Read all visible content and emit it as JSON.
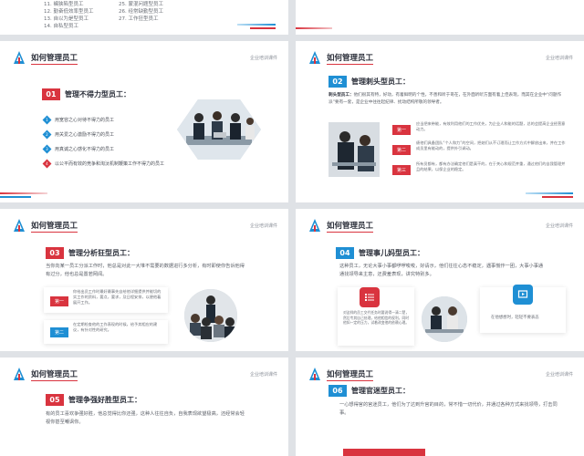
{
  "top_left": {
    "items": [
      "11. 褊狭陷型员工",
      "12. 勤奋低效率型员工",
      "13. 自以为是型员工",
      "14. 自私型员工"
    ],
    "items_right": [
      "25. 蒙混问题型员工",
      "26. 经常缺勤型员工",
      "27. 工作狂型员工"
    ]
  },
  "slides": [
    {
      "title": "如何管理员工",
      "subtitle": "企业培训课件",
      "section_number": "01",
      "section_title": "管理不得力型员工：",
      "bullets": [
        {
          "marker": "1",
          "text": "用宽容之心对待不得力的员工"
        },
        {
          "marker": "2",
          "text": "用关爱之心激励不得力的员工"
        },
        {
          "marker": "3",
          "text": "用真诚之心感化不得力的员工"
        },
        {
          "marker": "4",
          "text": "以公平而有效的竞争和淘汰机制鞭策工作不得力的员工"
        }
      ]
    },
    {
      "title": "如何管理员工",
      "subtitle": "企业培训课件",
      "section_number": "02",
      "section_title": "管理刺头型员工：",
      "intro_label": "刺头型员工：",
      "intro": "他们很其有特，好动，有着鲜明的个性，不善和听于哥在，在外面听听方面有着上佳表现，而其在企业中“问题作派”要有一套，是企业中往往起纪律、扰动结构所敬的领导者。",
      "tags": [
        "第一",
        "第二",
        "第三"
      ],
      "points": [
        "应当把来带能，有效利用他们的工作优先，为企业人和能的话题，总的会提高企业经营意动力。",
        "绩他们具备团队“个人和力”的空间，把她们从不订理而让工作方式中解放出来，并在工作成员里有能动的，提供外引调动。",
        "所有员都有，都有办法确定他们是真干的，在于关心和规范并重，通过他们的自我管理并且的结果，以保企业的稳定。"
      ]
    },
    {
      "title": "如何管理员工",
      "subtitle": "企业培训课件",
      "section_number": "03",
      "section_title": "管理分析狂型员工：",
      "intro": "当你向某一员工分派工作时，他总是对此一大堆不需要的数据进行多分析，有时即使你告诉他得有过分，他也总是置若罔闻。",
      "tags": [
        "第一",
        "第二"
      ],
      "points": [
        "你给出员工作时最好最事先自给他详细提供并能切的实工作的资料，要点，要求，及日程安排，以便他着展开工作。",
        "在定期检查他的工作表现的时候，给予其相应的建议，有针对性的研究。"
      ]
    },
    {
      "title": "如何管理员工",
      "subtitle": "企业培训课件",
      "section_number": "04",
      "section_title": "管理事儿妈型员工：",
      "intro": "这种员工，无论大事小事都啰啰唆唆，好请示，他们往往心态不稳定，遇事慌作一团，大事小事通通找领导来主意，还费羞表现，讲究特别多。",
      "card_left": "对这样的员工交代任务时要说得一清二楚，然后专其自己处理，给他相信的权利，同时他如一定的压力，试着改变他的依赖心理。",
      "card_right": "在他想想时，轻轻不要表态"
    },
    {
      "title": "如何管理员工",
      "subtitle": "企业培训课件",
      "section_number": "05",
      "section_title": "管理争强好胜型员工：",
      "intro": "有的员工喜欢争强好胜，他总觉得比你还强，这种人往往自负，自我表现欲望极高，还经常会轻视你甚至嘲讽你。"
    },
    {
      "title": "如何管理员工",
      "subtitle": "企业培训课件",
      "section_number": "06",
      "section_title": "管理官迷型员工：",
      "intro": "一心想得官的官迷员工，他们为了达到升官的目的，常不惜一切代价，并通过各种方式来找领导，打击同事。"
    }
  ],
  "colors": {
    "red": "#d9343f",
    "blue": "#1f8fd4",
    "dark": "#2b2f3a"
  }
}
